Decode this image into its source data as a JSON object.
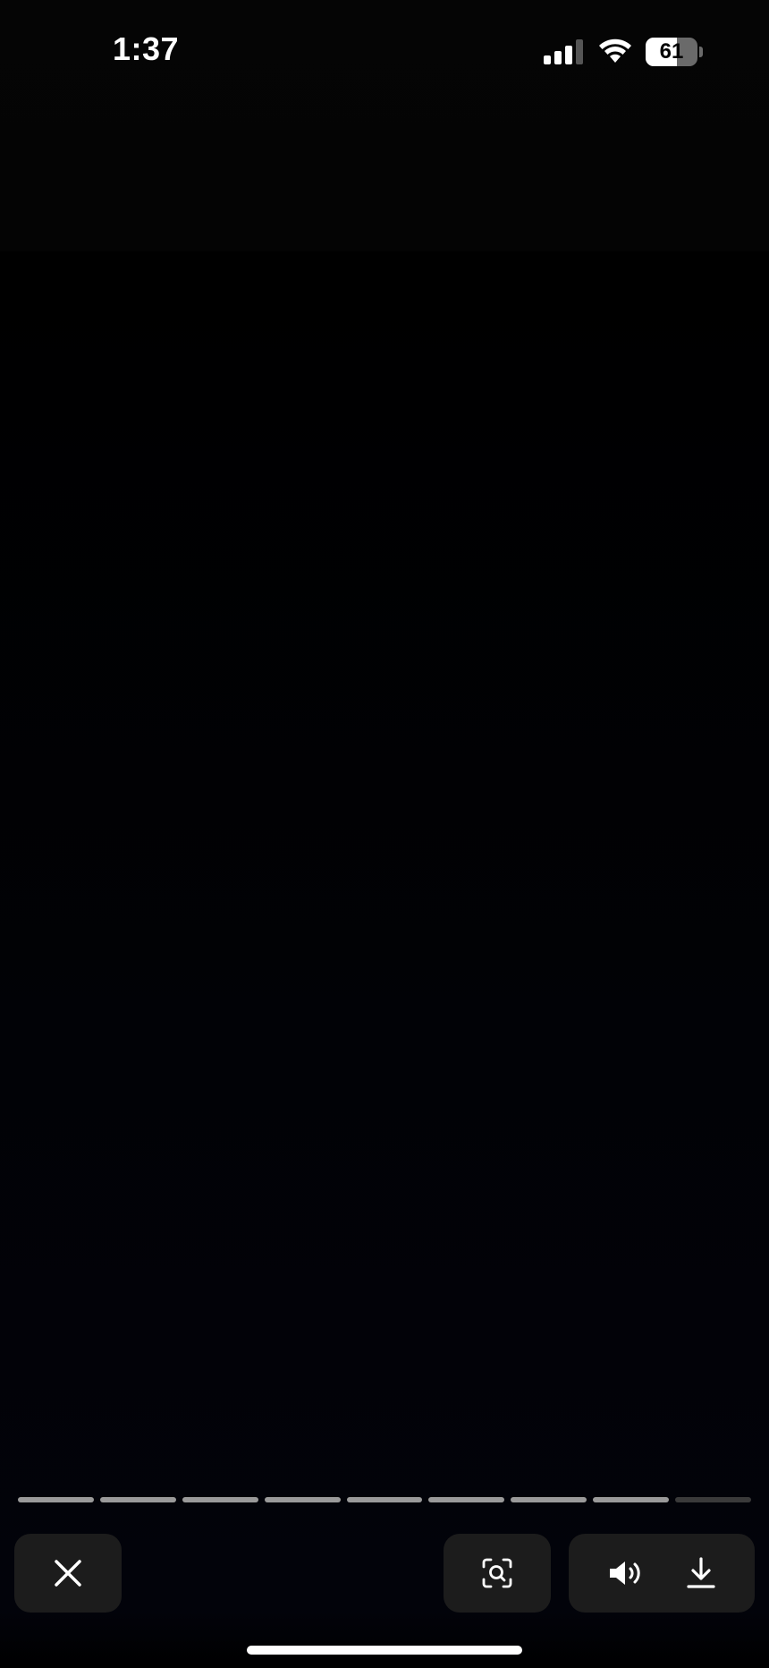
{
  "status_bar": {
    "time": "1:37",
    "battery_percent": "61",
    "battery_level": 0.61,
    "signal_bars": 3,
    "signal_bars_total": 4
  },
  "story_progress": {
    "segments_total": 9,
    "segments_viewed": 8
  },
  "controls": {
    "close_icon": "close-icon",
    "visual_search_icon": "visual-search-icon",
    "sound_icon": "speaker-icon",
    "download_icon": "download-icon"
  }
}
